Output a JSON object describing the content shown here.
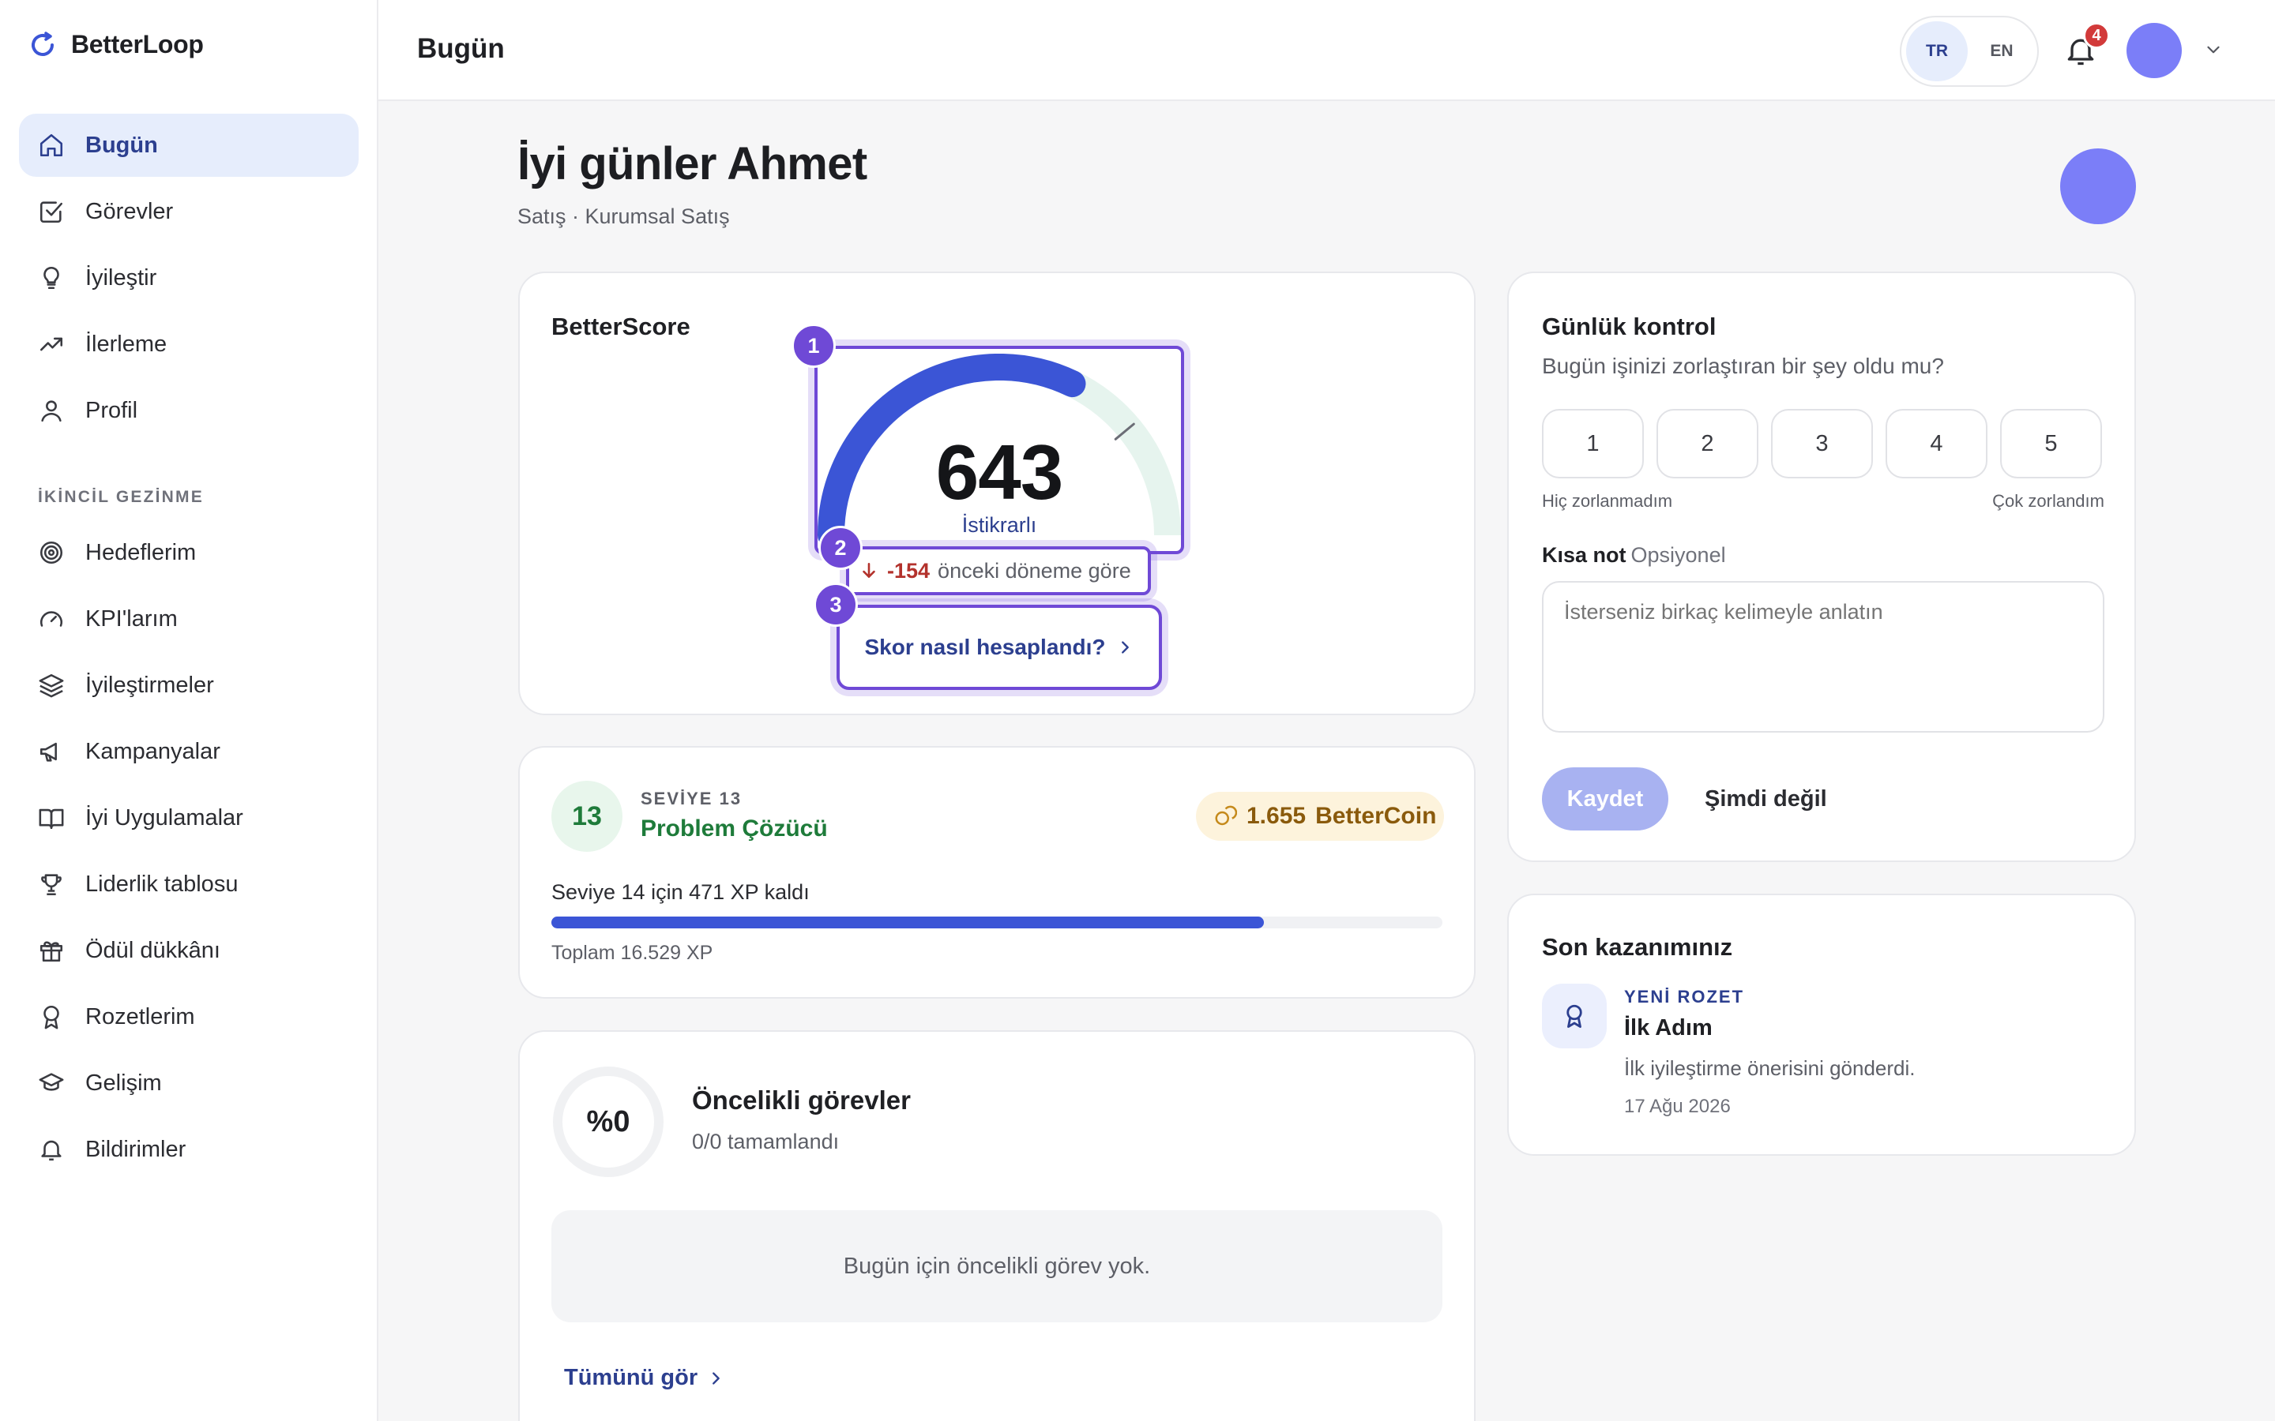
{
  "app": {
    "name": "BetterLoop",
    "accent": "#3b55d6",
    "highlight": "#6f49d6"
  },
  "sidebar": {
    "primary": [
      {
        "label": "Bugün",
        "icon": "home-icon",
        "active": true
      },
      {
        "label": "Görevler",
        "icon": "checkbox-icon"
      },
      {
        "label": "İyileştir",
        "icon": "lightbulb-icon"
      },
      {
        "label": "İlerleme",
        "icon": "trending-up-icon"
      },
      {
        "label": "Profil",
        "icon": "user-icon"
      }
    ],
    "secondary_title": "İKİNCİL GEZİNME",
    "secondary": [
      {
        "label": "Hedeflerim",
        "icon": "target-icon"
      },
      {
        "label": "KPI'larım",
        "icon": "gauge-icon"
      },
      {
        "label": "İyileştirmeler",
        "icon": "layers-icon"
      },
      {
        "label": "Kampanyalar",
        "icon": "megaphone-icon"
      },
      {
        "label": "İyi Uygulamalar",
        "icon": "book-icon"
      },
      {
        "label": "Liderlik tablosu",
        "icon": "trophy-icon"
      },
      {
        "label": "Ödül dükkânı",
        "icon": "gift-icon"
      },
      {
        "label": "Rozetlerim",
        "icon": "award-icon"
      },
      {
        "label": "Gelişim",
        "icon": "graduation-cap-icon"
      },
      {
        "label": "Bildirimler",
        "icon": "bell-icon"
      }
    ]
  },
  "header": {
    "title": "Bugün",
    "languages": [
      "TR",
      "EN"
    ],
    "active_language": "TR",
    "notification_count": "4"
  },
  "greeting": {
    "title": "İyi günler Ahmet",
    "subtitle": "Satış · Kurumsal Satış"
  },
  "score": {
    "title": "BetterScore",
    "value": "643",
    "fill_fraction": 0.643,
    "status": "İstikrarlı",
    "delta": "-154",
    "delta_text": "önceki döneme göre",
    "how_button": "Skor nasıl hesaplandı?",
    "steps": [
      "1",
      "2",
      "3"
    ]
  },
  "level": {
    "number": "13",
    "kicker": "SEVİYE 13",
    "name": "Problem Çözücü",
    "coins": "1.655",
    "coins_label": "BetterCoin",
    "xp_remaining": "Seviye 14 için 471 XP kaldı",
    "xp_progress": 0.8,
    "xp_total": "Toplam 16.529 XP"
  },
  "priority": {
    "percent": "%0",
    "title": "Öncelikli görevler",
    "subtitle": "0/0 tamamlandı",
    "empty": "Bugün için öncelikli görev yok.",
    "see_all": "Tümünü gör"
  },
  "daily": {
    "title": "Günlük kontrol",
    "question": "Bugün işinizi zorlaştıran bir şey oldu mu?",
    "ratings": [
      "1",
      "2",
      "3",
      "4",
      "5"
    ],
    "low_label": "Hiç zorlanmadım",
    "high_label": "Çok zorlandım",
    "note_label": "Kısa not",
    "note_optional": "Opsiyonel",
    "note_placeholder": "İsterseniz birkaç kelimeyle anlatın",
    "save": "Kaydet",
    "later": "Şimdi değil"
  },
  "achievement": {
    "title": "Son kazanımınız",
    "kicker": "YENİ ROZET",
    "name": "İlk Adım",
    "description": "İlk iyileştirme önerisini gönderdi.",
    "date": "17 Ağu 2026"
  }
}
